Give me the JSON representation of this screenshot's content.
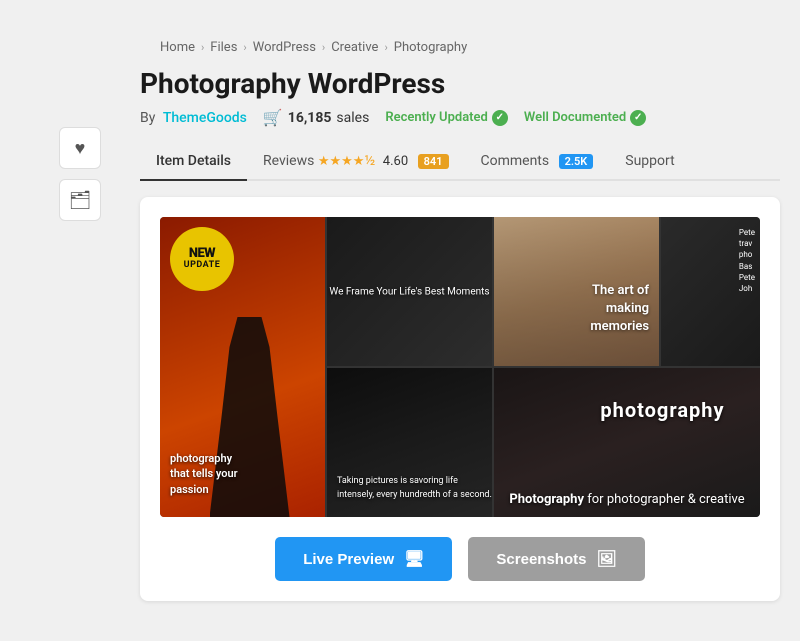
{
  "breadcrumb": {
    "items": [
      "Home",
      "Files",
      "WordPress",
      "Creative",
      "Photography"
    ]
  },
  "product": {
    "title": "Photography WordPress",
    "author": "ThemeGoods",
    "author_label": "By",
    "sales_count": "16,185",
    "sales_label": "sales",
    "badges": {
      "recently_updated": "Recently Updated",
      "well_documented": "Well Documented"
    }
  },
  "tabs": {
    "item_details": "Item Details",
    "reviews": "Reviews",
    "rating": "4.60",
    "review_count": "841",
    "comments": "Comments",
    "comment_count": "2.5K",
    "support": "Support"
  },
  "preview": {
    "new_badge_line1": "NEW",
    "new_badge_line2": "UPDATE",
    "overlay_frame": "We Frame Your Life's Best Moments",
    "overlay_photography": "photography",
    "overlay_art": "The art of\nmaking\nmemories",
    "overlay_photo_bottom": "Photography for photographer & creative",
    "overlay_taking": "Taking pictures is savoring\nlife intensely, every\nhundredth of a second.",
    "sidebar_text": "Pete\ntrav\npho\nBas\nPete\nJoh"
  },
  "buttons": {
    "live_preview": "Live Preview",
    "screenshots": "Screenshots"
  },
  "sidebar": {
    "heart_icon": "♥",
    "folder_icon": "🗂"
  },
  "colors": {
    "author_link": "#00bcd4",
    "badge_green": "#4caf50",
    "tab_active_border": "#333333",
    "review_count_bg": "#e8a020",
    "comment_count_bg": "#2196f3",
    "live_preview_btn": "#2196f3",
    "screenshots_btn": "#9e9e9e",
    "new_badge_bg": "#e8c400"
  }
}
